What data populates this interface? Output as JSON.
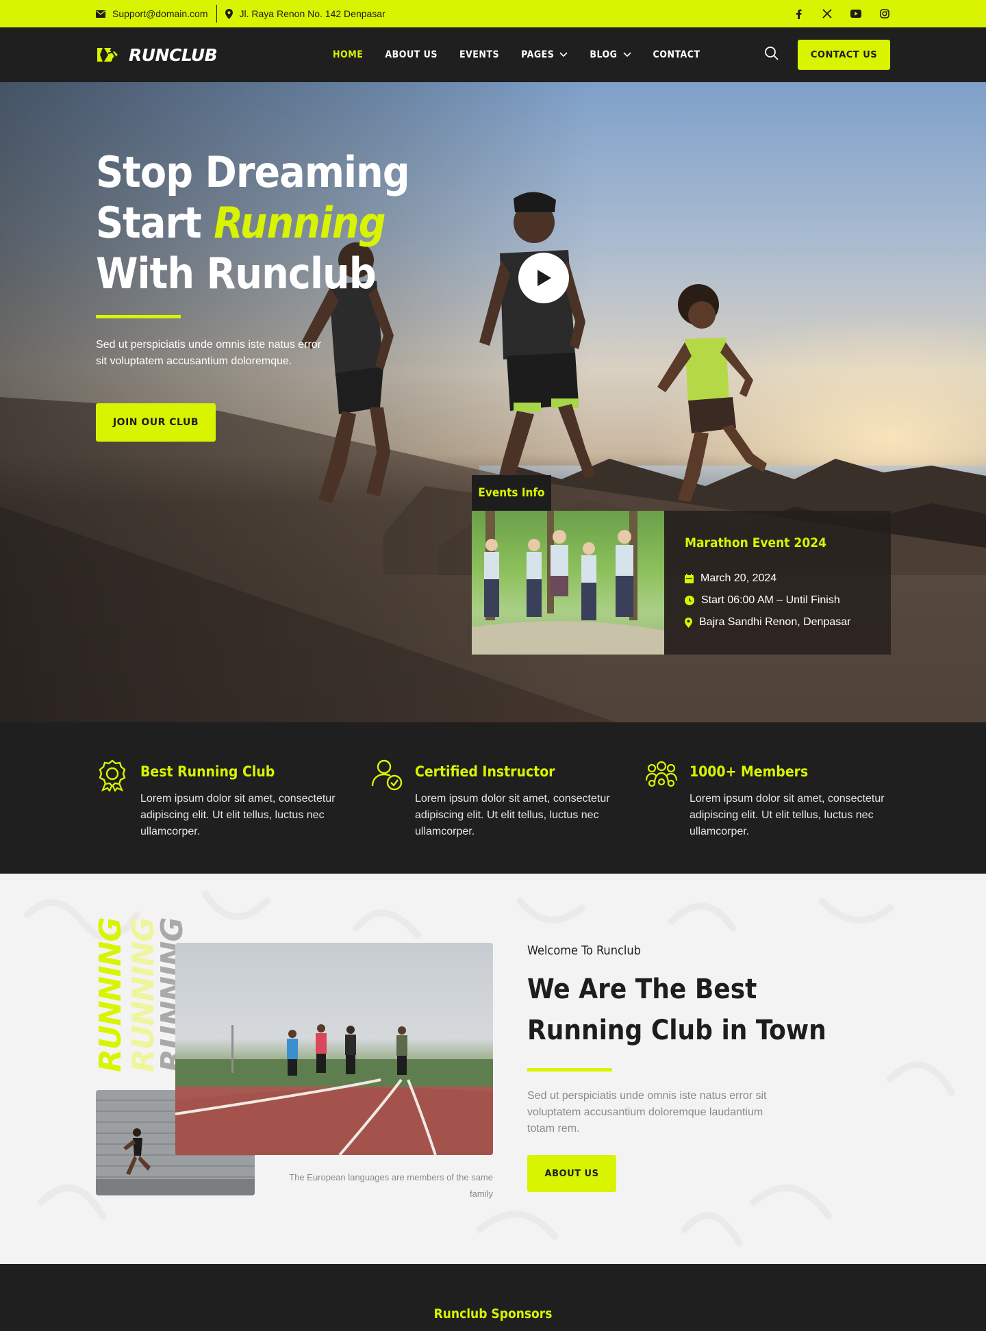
{
  "topbar": {
    "email": "Support@domain.com",
    "address": "Jl. Raya Renon No. 142 Denpasar",
    "socials": [
      "facebook-icon",
      "x-icon",
      "youtube-icon",
      "instagram-icon"
    ]
  },
  "nav": {
    "logo_text": "RUNCLUB",
    "items": [
      {
        "label": "HOME",
        "active": true
      },
      {
        "label": "ABOUT US"
      },
      {
        "label": "EVENTS"
      },
      {
        "label": "PAGES",
        "dropdown": true
      },
      {
        "label": "BLOG",
        "dropdown": true
      },
      {
        "label": "CONTACT"
      }
    ],
    "cta": "CONTACT US"
  },
  "hero": {
    "title_line1": "Stop Dreaming",
    "title_line2_prefix": "Start ",
    "title_line2_accent": "Running",
    "title_line3": "With Runclub",
    "description": "Sed ut perspiciatis unde omnis iste natus error sit voluptatem accusantium doloremque.",
    "button": "JOIN OUR CLUB"
  },
  "event": {
    "tab": "Events Info",
    "title": "Marathon Event 2024",
    "date": "March 20, 2024",
    "time": "Start 06:00 AM – Until Finish",
    "location": "Bajra Sandhi Renon, Denpasar"
  },
  "features": [
    {
      "icon": "award-icon",
      "title": "Best Running Club",
      "text": "Lorem ipsum dolor sit amet, consectetur adipiscing elit. Ut elit tellus, luctus nec ullamcorper."
    },
    {
      "icon": "certified-user-icon",
      "title": "Certified Instructor",
      "text": "Lorem ipsum dolor sit amet, consectetur adipiscing elit. Ut elit tellus, luctus nec ullamcorper."
    },
    {
      "icon": "members-icon",
      "title": "1000+ Members",
      "text": "Lorem ipsum dolor sit amet, consectetur adipiscing elit. Ut elit tellus, luctus nec ullamcorper."
    }
  ],
  "about": {
    "vertical_word": "RUNNING",
    "caption": "The European languages are members of the same family",
    "kicker": "Welcome To Runclub",
    "title": "We Are The Best Running Club in Town",
    "description": "Sed ut perspiciatis unde omnis iste natus error sit voluptatem accusantium doloremque laudantium totam rem.",
    "button": "ABOUT US"
  },
  "sponsors": {
    "title": "Runclub Sponsors"
  },
  "colors": {
    "accent": "#d8f400",
    "dark": "#1f1f1f"
  }
}
